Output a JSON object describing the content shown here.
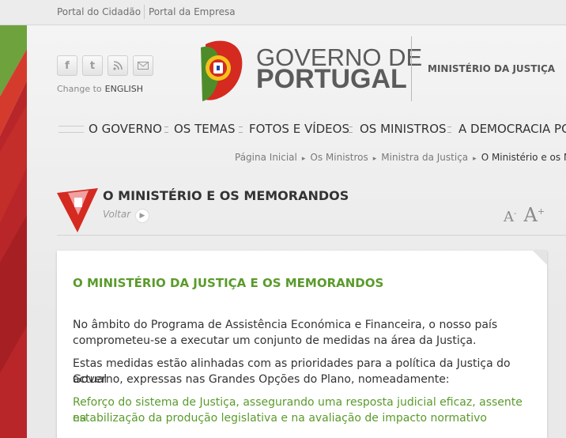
{
  "topbar": {
    "link1": "Portal do Cidadão",
    "link2": "Portal da Empresa"
  },
  "social": {
    "icons": [
      "facebook-icon",
      "twitter-icon",
      "rss-icon",
      "email-icon"
    ],
    "change_to": "Change to",
    "language": "ENGLISH"
  },
  "brand": {
    "line1": "GOVERNO DE",
    "line2": "PORTUGAL",
    "ministry": "MINISTÉRIO DA JUSTIÇA"
  },
  "nav": {
    "items": [
      "O GOVERNO",
      "OS TEMAS",
      "FOTOS E VÍDEOS",
      "OS MINISTROS",
      "A DEMOCRACIA PO"
    ]
  },
  "breadcrumb": {
    "items": [
      "Página Inicial",
      "Os Ministros",
      "Ministra da Justiça"
    ],
    "current": "O Ministério e os M"
  },
  "page": {
    "title": "O MINISTÉRIO E OS MEMORANDOS",
    "back": "Voltar",
    "font_small": "A",
    "font_small_sign": "-",
    "font_big": "A",
    "font_big_sign": "+"
  },
  "article": {
    "heading": "O MINISTÉRIO DA JUSTIÇA E OS MEMORANDOS",
    "p1_l1": "No âmbito do Programa de Assistência Económica e Financeira, o nosso país",
    "p1_l2": "comprometeu-se a executar um conjunto de medidas na área da Justiça.",
    "p2_l1": "Estas medidas estão alinhadas com as prioridades para a política da Justiça do actual",
    "p2_l2": "Governo, expressas nas Grandes Opções do Plano, nomeadamente:",
    "p3_l1": "Reforço do sistema de Justiça, assegurando uma resposta judicial eficaz, assente na",
    "p3_l2": "estabilização da produção legislativa e na avaliação de impacto normativo"
  },
  "colors": {
    "green": "#5a9b2b",
    "red": "#d42a20"
  }
}
